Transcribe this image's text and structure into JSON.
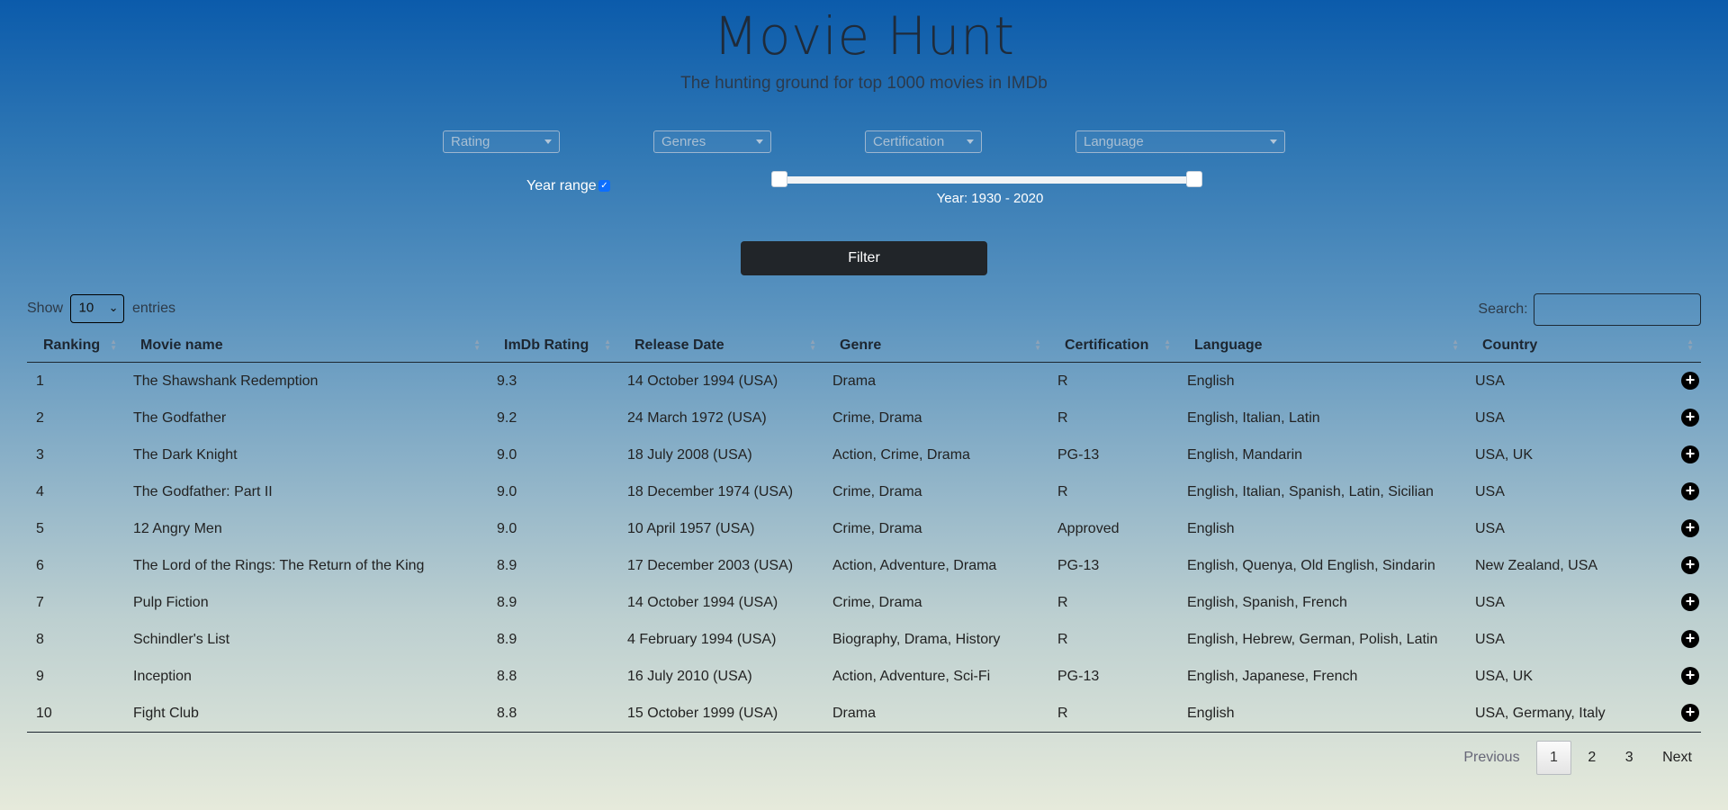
{
  "header": {
    "title": "Movie Hunt",
    "subtitle": "The hunting ground for top 1000 movies in IMDb"
  },
  "filters": {
    "rating": "Rating",
    "genres": "Genres",
    "certification": "Certification",
    "language": "Language",
    "year_range_label": "Year range",
    "year_range_checked": true,
    "year_caption": "Year: 1930 - 2020",
    "year_min": 1930,
    "year_max": 2020,
    "filter_button": "Filter"
  },
  "table_controls": {
    "show_label": "Show",
    "entries_value": "10",
    "entries_label": "entries",
    "search_label": "Search:",
    "search_value": ""
  },
  "columns": [
    "Ranking",
    "Movie name",
    "ImDb Rating",
    "Release Date",
    "Genre",
    "Certification",
    "Language",
    "Country"
  ],
  "rows": [
    [
      "1",
      "The Shawshank Redemption",
      "9.3",
      "14 October 1994 (USA)",
      "Drama",
      "R",
      "English",
      "USA"
    ],
    [
      "2",
      "The Godfather",
      "9.2",
      "24 March 1972 (USA)",
      "Crime, Drama",
      "R",
      "English, Italian, Latin",
      "USA"
    ],
    [
      "3",
      "The Dark Knight",
      "9.0",
      "18 July 2008 (USA)",
      "Action, Crime, Drama",
      "PG-13",
      "English, Mandarin",
      "USA, UK"
    ],
    [
      "4",
      "The Godfather: Part II",
      "9.0",
      "18 December 1974 (USA)",
      "Crime, Drama",
      "R",
      "English, Italian, Spanish, Latin, Sicilian",
      "USA"
    ],
    [
      "5",
      "12 Angry Men",
      "9.0",
      "10 April 1957 (USA)",
      "Crime, Drama",
      "Approved",
      "English",
      "USA"
    ],
    [
      "6",
      "The Lord of the Rings: The Return of the King",
      "8.9",
      "17 December 2003 (USA)",
      "Action, Adventure, Drama",
      "PG-13",
      "English, Quenya, Old English, Sindarin",
      "New Zealand, USA"
    ],
    [
      "7",
      "Pulp Fiction",
      "8.9",
      "14 October 1994 (USA)",
      "Crime, Drama",
      "R",
      "English, Spanish, French",
      "USA"
    ],
    [
      "8",
      "Schindler's List",
      "8.9",
      "4 February 1994 (USA)",
      "Biography, Drama, History",
      "R",
      "English, Hebrew, German, Polish, Latin",
      "USA"
    ],
    [
      "9",
      "Inception",
      "8.8",
      "16 July 2010 (USA)",
      "Action, Adventure, Sci-Fi",
      "PG-13",
      "English, Japanese, French",
      "USA, UK"
    ],
    [
      "10",
      "Fight Club",
      "8.8",
      "15 October 1999 (USA)",
      "Drama",
      "R",
      "English",
      "USA, Germany, Italy"
    ]
  ],
  "pagination": {
    "previous": "Previous",
    "pages": [
      "1",
      "2",
      "3"
    ],
    "current": "1",
    "next": "Next"
  },
  "icons": {
    "row_action": "plus-circle-icon",
    "sort": "sort-arrows-icon",
    "dropdown": "caret-down-icon"
  }
}
